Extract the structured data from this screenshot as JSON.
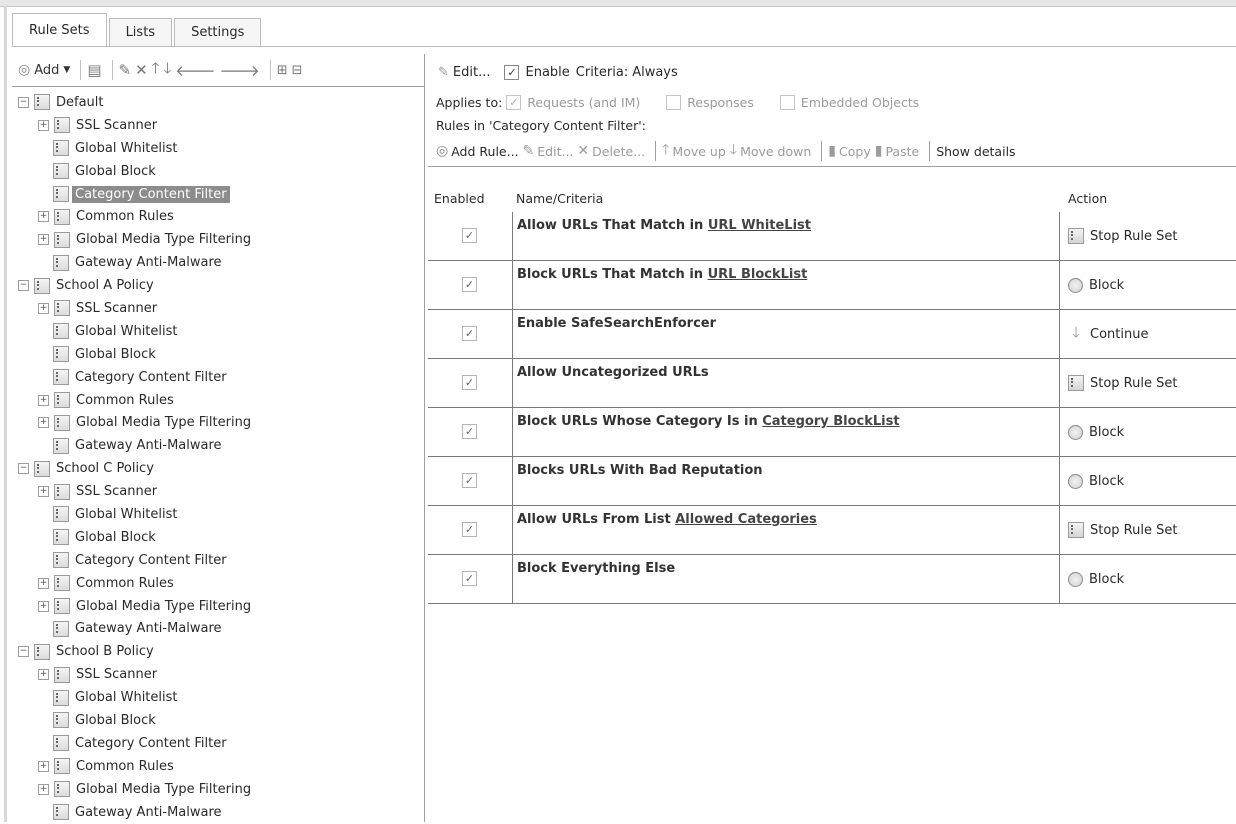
{
  "tabs": [
    {
      "label": "Rule Sets"
    },
    {
      "label": "Lists"
    },
    {
      "label": "Settings"
    }
  ],
  "left_toolbar": {
    "add_label": "Add",
    "icons": [
      "add-icon",
      "dropdown-arrow-icon",
      "ruleset-icon",
      "edit-icon",
      "delete-icon",
      "move-up-icon",
      "move-down-icon",
      "move-left-icon",
      "move-right-icon",
      "expand-all-icon",
      "collapse-all-icon"
    ]
  },
  "tree": [
    {
      "label": "Default",
      "expander": "−"
    },
    {
      "label": "SSL Scanner",
      "expander": "+"
    },
    {
      "label": "Global Whitelist",
      "expander": ""
    },
    {
      "label": "Global Block",
      "expander": ""
    },
    {
      "label": "Category Content Filter",
      "expander": ""
    },
    {
      "label": "Common Rules",
      "expander": "+"
    },
    {
      "label": "Global Media Type Filtering",
      "expander": "+"
    },
    {
      "label": "Gateway Anti-Malware",
      "expander": ""
    },
    {
      "label": "School A Policy",
      "expander": "−"
    },
    {
      "label": "SSL Scanner",
      "expander": "+"
    },
    {
      "label": "Global Whitelist",
      "expander": ""
    },
    {
      "label": "Global Block",
      "expander": ""
    },
    {
      "label": "Category Content Filter",
      "expander": ""
    },
    {
      "label": "Common Rules",
      "expander": "+"
    },
    {
      "label": "Global Media Type Filtering",
      "expander": "+"
    },
    {
      "label": "Gateway Anti-Malware",
      "expander": ""
    },
    {
      "label": "School C Policy",
      "expander": "−"
    },
    {
      "label": "SSL Scanner",
      "expander": "+"
    },
    {
      "label": "Global Whitelist",
      "expander": ""
    },
    {
      "label": "Global Block",
      "expander": ""
    },
    {
      "label": "Category Content Filter",
      "expander": ""
    },
    {
      "label": "Common Rules",
      "expander": "+"
    },
    {
      "label": "Global Media Type Filtering",
      "expander": "+"
    },
    {
      "label": "Gateway Anti-Malware",
      "expander": ""
    },
    {
      "label": "School B Policy",
      "expander": "−"
    },
    {
      "label": "SSL Scanner",
      "expander": "+"
    },
    {
      "label": "Global Whitelist",
      "expander": ""
    },
    {
      "label": "Global Block",
      "expander": ""
    },
    {
      "label": "Category Content Filter",
      "expander": ""
    },
    {
      "label": "Common Rules",
      "expander": "+"
    },
    {
      "label": "Global Media Type Filtering",
      "expander": "+"
    },
    {
      "label": "Gateway Anti-Malware",
      "expander": ""
    }
  ],
  "ruleset_header": {
    "edit_label": "Edit...",
    "enable_label": "Enable",
    "enable_checked": true,
    "criteria_label": "Criteria:",
    "criteria_value": "Always"
  },
  "applies_to": {
    "label": "Applies to:",
    "options": [
      {
        "label": "Requests (and IM)",
        "checked": true
      },
      {
        "label": "Responses",
        "checked": false
      },
      {
        "label": "Embedded Objects",
        "checked": false
      }
    ]
  },
  "rules_title": "Rules in 'Category Content Filter':",
  "rules_toolbar": {
    "add_rule": "Add Rule...",
    "edit": "Edit...",
    "delete": "Delete...",
    "move_up": "Move up",
    "move_down": "Move down",
    "copy": "Copy",
    "paste": "Paste",
    "show_details": "Show details"
  },
  "rules_columns": {
    "enabled": "Enabled",
    "name": "Name/Criteria",
    "action": "Action"
  },
  "rules": [
    {
      "name": "Allow URLs That Match in ",
      "link": "URL WhiteList",
      "enabled": true,
      "action": "Stop Rule Set",
      "action_icon": "stop-rule-set-icon"
    },
    {
      "name": "Block URLs That Match in ",
      "link": "URL BlockList",
      "enabled": true,
      "action": "Block",
      "action_icon": "block-icon"
    },
    {
      "name": "Enable SafeSearchEnforcer",
      "link": "",
      "enabled": true,
      "action": "Continue",
      "action_icon": "continue-icon"
    },
    {
      "name": "Allow Uncategorized URLs",
      "link": "",
      "enabled": true,
      "action": "Stop Rule Set",
      "action_icon": "stop-rule-set-icon"
    },
    {
      "name": "Block URLs Whose Category Is in ",
      "link": "Category BlockList",
      "enabled": true,
      "action": "Block",
      "action_icon": "block-icon"
    },
    {
      "name": "Blocks URLs With Bad Reputation",
      "link": "",
      "enabled": true,
      "action": "Block",
      "action_icon": "block-icon"
    },
    {
      "name": "Allow URLs From List ",
      "link": "Allowed Categories",
      "enabled": true,
      "action": "Stop Rule Set",
      "action_icon": "stop-rule-set-icon"
    },
    {
      "name": "Block Everything Else",
      "link": "",
      "enabled": true,
      "action": "Block",
      "action_icon": "block-icon"
    }
  ]
}
